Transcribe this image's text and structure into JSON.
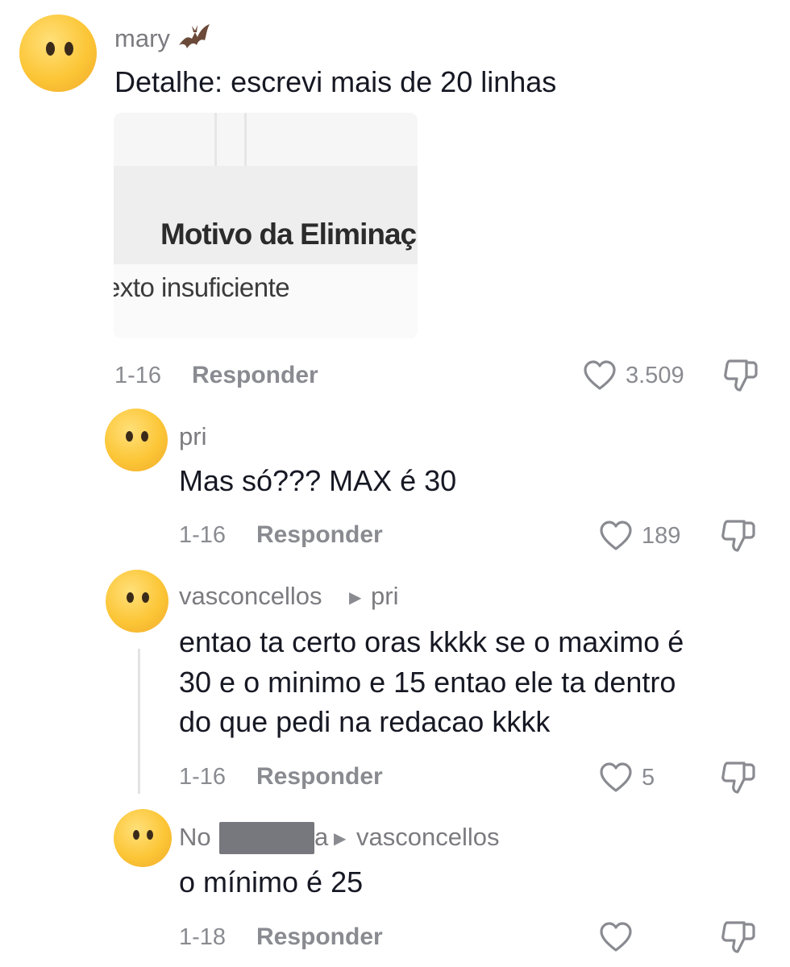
{
  "comments": [
    {
      "username": "mary",
      "text": "Detalhe: escrevi mais de 20 linhas",
      "image": {
        "title": "Motivo da Eliminaç",
        "subtitle": "exto insuficiente"
      },
      "date": "1-16",
      "reply_label": "Responder",
      "likes": "3.509"
    },
    {
      "username": "pri",
      "text": "Mas só??? MAX é 30",
      "date": "1-16",
      "reply_label": "Responder",
      "likes": "189"
    },
    {
      "username": "vasconcellos",
      "reply_to": "pri",
      "text_lines": [
        "entao ta certo oras kkkk se o maximo é",
        "30 e o minimo e 15 entao ele ta dentro",
        "do que pedi na redacao kkkk"
      ],
      "date": "1-16",
      "reply_label": "Responder",
      "likes": "5"
    },
    {
      "username_visible_start": "No",
      "username_visible_end": "a",
      "reply_to": "vasconcellos",
      "text": "o mínimo é 25",
      "date": "1-18",
      "reply_label": "Responder",
      "likes": ""
    }
  ],
  "icons": {
    "avatar": "neutral-face-emoji",
    "badge": "bat-icon",
    "like": "heart-outline-icon",
    "dislike": "thumbs-down-icon",
    "reply_arrow": "caret-right-icon"
  },
  "colors": {
    "text": "#161823",
    "muted": "#8a8b91",
    "username": "#7b7b80"
  }
}
